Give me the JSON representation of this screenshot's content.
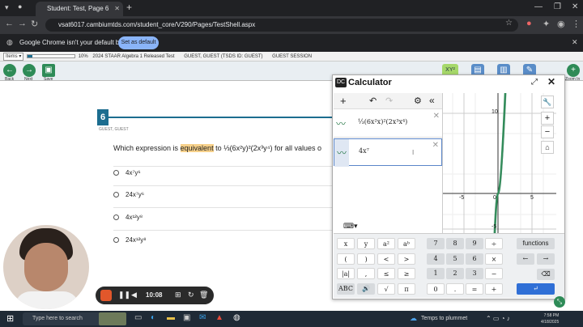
{
  "browser": {
    "tab_title": "Student: Test, Page 6",
    "url": "vsat6017.cambiumtds.com/student_core/V290/Pages/TestShell.aspx",
    "info_text": "Google Chrome isn't your default browser",
    "set_default_label": "Set as default"
  },
  "test_strip": {
    "items_label": "Items",
    "progress_label": "10%",
    "test_name": "2024 STAAR Algebra 1 Released Test",
    "student": "GUEST, GUEST (TSDS ID: GUEST)",
    "session": "GUEST SESSION"
  },
  "tools": {
    "back": "Back",
    "next": "Next",
    "save": "Save",
    "zoom_in": "Zoom In"
  },
  "question": {
    "number": "6",
    "guest_label": "GUEST, GUEST",
    "stem_pre": "Which expression is ",
    "stem_highlight": "equivalent",
    "stem_post": " to ⅓(6x²y)²(2x³y⁴) for all values o",
    "options": [
      "4x⁷y⁶",
      "24x⁷y⁶",
      "4x¹²y⁸",
      "24x¹²y⁸"
    ]
  },
  "recorder": {
    "time": "10:08"
  },
  "calculator": {
    "title": "Calculator",
    "expr1": "⅓(6x²x)²(2x³x⁴)",
    "expr2": "4x⁷",
    "graph_labels": {
      "y_top": "10",
      "y_bot": "-5",
      "x_left": "-5",
      "x_mid": "0",
      "x_right": "5"
    },
    "keys_left": [
      [
        "x",
        "y",
        "a²",
        "aᵇ"
      ],
      [
        "(",
        ")",
        "<",
        ">"
      ],
      [
        "|a|",
        ",",
        "≤",
        "≥"
      ],
      [
        "ABC",
        "🔊",
        "√",
        "π"
      ]
    ],
    "keys_num": [
      [
        "7",
        "8",
        "9",
        "÷"
      ],
      [
        "4",
        "5",
        "6",
        "×"
      ],
      [
        "1",
        "2",
        "3",
        "−"
      ],
      [
        "0",
        ".",
        "=",
        "+"
      ]
    ],
    "functions_label": "functions"
  },
  "taskbar": {
    "search_placeholder": "Type here to search",
    "weather": "Temps to plummet",
    "time": "7:58 PM",
    "date": "4/18/2025"
  }
}
